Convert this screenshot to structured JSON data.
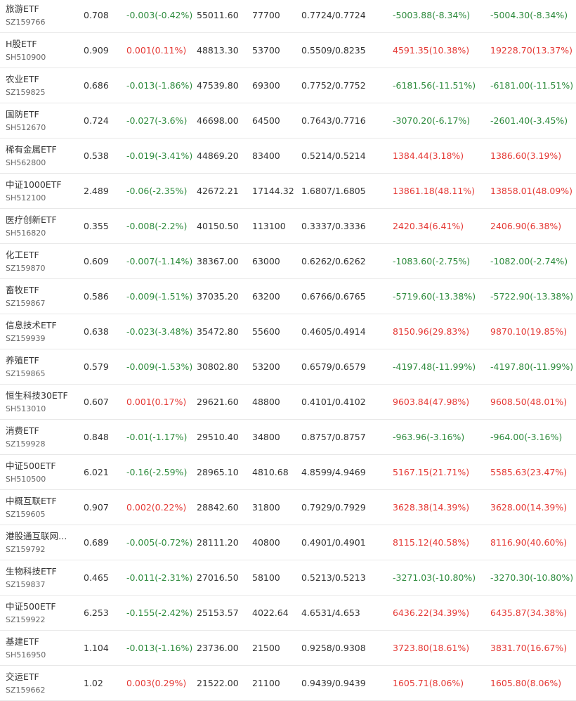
{
  "colors": {
    "positive": "#e53935",
    "negative": "#2e8b3d",
    "text": "#333333",
    "subtext": "#666666",
    "divider": "#e8e8e8"
  },
  "rows": [
    {
      "name": "旅游ETF",
      "code": "SZ159766",
      "price": "0.708",
      "change": "-0.003(-0.42%)",
      "change_sign": "neg",
      "scale": "55011.60",
      "shares": "77700",
      "nav": "0.7724/0.7724",
      "pnl1": "-5003.88(-8.34%)",
      "pnl1_sign": "neg",
      "pnl2": "-5004.30(-8.34%)",
      "pnl2_sign": "neg"
    },
    {
      "name": "H股ETF",
      "code": "SH510900",
      "price": "0.909",
      "change": "0.001(0.11%)",
      "change_sign": "pos",
      "scale": "48813.30",
      "shares": "53700",
      "nav": "0.5509/0.8235",
      "pnl1": "4591.35(10.38%)",
      "pnl1_sign": "pos",
      "pnl2": "19228.70(13.37%)",
      "pnl2_sign": "pos"
    },
    {
      "name": "农业ETF",
      "code": "SZ159825",
      "price": "0.686",
      "change": "-0.013(-1.86%)",
      "change_sign": "neg",
      "scale": "47539.80",
      "shares": "69300",
      "nav": "0.7752/0.7752",
      "pnl1": "-6181.56(-11.51%)",
      "pnl1_sign": "neg",
      "pnl2": "-6181.00(-11.51%)",
      "pnl2_sign": "neg"
    },
    {
      "name": "国防ETF",
      "code": "SH512670",
      "price": "0.724",
      "change": "-0.027(-3.6%)",
      "change_sign": "neg",
      "scale": "46698.00",
      "shares": "64500",
      "nav": "0.7643/0.7716",
      "pnl1": "-3070.20(-6.17%)",
      "pnl1_sign": "neg",
      "pnl2": "-2601.40(-3.45%)",
      "pnl2_sign": "neg"
    },
    {
      "name": "稀有金属ETF",
      "code": "SH562800",
      "price": "0.538",
      "change": "-0.019(-3.41%)",
      "change_sign": "neg",
      "scale": "44869.20",
      "shares": "83400",
      "nav": "0.5214/0.5214",
      "pnl1": "1384.44(3.18%)",
      "pnl1_sign": "pos",
      "pnl2": "1386.60(3.19%)",
      "pnl2_sign": "pos"
    },
    {
      "name": "中证1000ETF",
      "code": "SH512100",
      "price": "2.489",
      "change": "-0.06(-2.35%)",
      "change_sign": "neg",
      "scale": "42672.21",
      "shares": "17144.32",
      "nav": "1.6807/1.6805",
      "pnl1": "13861.18(48.11%)",
      "pnl1_sign": "pos",
      "pnl2": "13858.01(48.09%)",
      "pnl2_sign": "pos"
    },
    {
      "name": "医疗创新ETF",
      "code": "SH516820",
      "price": "0.355",
      "change": "-0.008(-2.2%)",
      "change_sign": "neg",
      "scale": "40150.50",
      "shares": "113100",
      "nav": "0.3337/0.3336",
      "pnl1": "2420.34(6.41%)",
      "pnl1_sign": "pos",
      "pnl2": "2406.90(6.38%)",
      "pnl2_sign": "pos"
    },
    {
      "name": "化工ETF",
      "code": "SZ159870",
      "price": "0.609",
      "change": "-0.007(-1.14%)",
      "change_sign": "neg",
      "scale": "38367.00",
      "shares": "63000",
      "nav": "0.6262/0.6262",
      "pnl1": "-1083.60(-2.75%)",
      "pnl1_sign": "neg",
      "pnl2": "-1082.00(-2.74%)",
      "pnl2_sign": "neg"
    },
    {
      "name": "畜牧ETF",
      "code": "SZ159867",
      "price": "0.586",
      "change": "-0.009(-1.51%)",
      "change_sign": "neg",
      "scale": "37035.20",
      "shares": "63200",
      "nav": "0.6766/0.6765",
      "pnl1": "-5719.60(-13.38%)",
      "pnl1_sign": "neg",
      "pnl2": "-5722.90(-13.38%)",
      "pnl2_sign": "neg"
    },
    {
      "name": "信息技术ETF",
      "code": "SZ159939",
      "price": "0.638",
      "change": "-0.023(-3.48%)",
      "change_sign": "neg",
      "scale": "35472.80",
      "shares": "55600",
      "nav": "0.4605/0.4914",
      "pnl1": "8150.96(29.83%)",
      "pnl1_sign": "pos",
      "pnl2": "9870.10(19.85%)",
      "pnl2_sign": "pos"
    },
    {
      "name": "养殖ETF",
      "code": "SZ159865",
      "price": "0.579",
      "change": "-0.009(-1.53%)",
      "change_sign": "neg",
      "scale": "30802.80",
      "shares": "53200",
      "nav": "0.6579/0.6579",
      "pnl1": "-4197.48(-11.99%)",
      "pnl1_sign": "neg",
      "pnl2": "-4197.80(-11.99%)",
      "pnl2_sign": "neg"
    },
    {
      "name": "恒生科技30ETF",
      "code": "SH513010",
      "price": "0.607",
      "change": "0.001(0.17%)",
      "change_sign": "pos",
      "scale": "29621.60",
      "shares": "48800",
      "nav": "0.4101/0.4102",
      "pnl1": "9603.84(47.98%)",
      "pnl1_sign": "pos",
      "pnl2": "9608.50(48.01%)",
      "pnl2_sign": "pos"
    },
    {
      "name": "消费ETF",
      "code": "SZ159928",
      "price": "0.848",
      "change": "-0.01(-1.17%)",
      "change_sign": "neg",
      "scale": "29510.40",
      "shares": "34800",
      "nav": "0.8757/0.8757",
      "pnl1": "-963.96(-3.16%)",
      "pnl1_sign": "neg",
      "pnl2": "-964.00(-3.16%)",
      "pnl2_sign": "neg"
    },
    {
      "name": "中证500ETF",
      "code": "SH510500",
      "price": "6.021",
      "change": "-0.16(-2.59%)",
      "change_sign": "neg",
      "scale": "28965.10",
      "shares": "4810.68",
      "nav": "4.8599/4.9469",
      "pnl1": "5167.15(21.71%)",
      "pnl1_sign": "pos",
      "pnl2": "5585.63(23.47%)",
      "pnl2_sign": "pos"
    },
    {
      "name": "中概互联ETF",
      "code": "SZ159605",
      "price": "0.907",
      "change": "0.002(0.22%)",
      "change_sign": "pos",
      "scale": "28842.60",
      "shares": "31800",
      "nav": "0.7929/0.7929",
      "pnl1": "3628.38(14.39%)",
      "pnl1_sign": "pos",
      "pnl2": "3628.00(14.39%)",
      "pnl2_sign": "pos"
    },
    {
      "name": "港股通互联网…",
      "code": "SZ159792",
      "price": "0.689",
      "change": "-0.005(-0.72%)",
      "change_sign": "neg",
      "scale": "28111.20",
      "shares": "40800",
      "nav": "0.4901/0.4901",
      "pnl1": "8115.12(40.58%)",
      "pnl1_sign": "pos",
      "pnl2": "8116.90(40.60%)",
      "pnl2_sign": "pos"
    },
    {
      "name": "生物科技ETF",
      "code": "SZ159837",
      "price": "0.465",
      "change": "-0.011(-2.31%)",
      "change_sign": "neg",
      "scale": "27016.50",
      "shares": "58100",
      "nav": "0.5213/0.5213",
      "pnl1": "-3271.03(-10.80%)",
      "pnl1_sign": "neg",
      "pnl2": "-3270.30(-10.80%)",
      "pnl2_sign": "neg"
    },
    {
      "name": "中证500ETF",
      "code": "SZ159922",
      "price": "6.253",
      "change": "-0.155(-2.42%)",
      "change_sign": "neg",
      "scale": "25153.57",
      "shares": "4022.64",
      "nav": "4.6531/4.653",
      "pnl1": "6436.22(34.39%)",
      "pnl1_sign": "pos",
      "pnl2": "6435.87(34.38%)",
      "pnl2_sign": "pos"
    },
    {
      "name": "基建ETF",
      "code": "SH516950",
      "price": "1.104",
      "change": "-0.013(-1.16%)",
      "change_sign": "neg",
      "scale": "23736.00",
      "shares": "21500",
      "nav": "0.9258/0.9308",
      "pnl1": "3723.80(18.61%)",
      "pnl1_sign": "pos",
      "pnl2": "3831.70(16.67%)",
      "pnl2_sign": "pos"
    },
    {
      "name": "交运ETF",
      "code": "SZ159662",
      "price": "1.02",
      "change": "0.003(0.29%)",
      "change_sign": "pos",
      "scale": "21522.00",
      "shares": "21100",
      "nav": "0.9439/0.9439",
      "pnl1": "1605.71(8.06%)",
      "pnl1_sign": "pos",
      "pnl2": "1605.80(8.06%)",
      "pnl2_sign": "pos"
    }
  ]
}
